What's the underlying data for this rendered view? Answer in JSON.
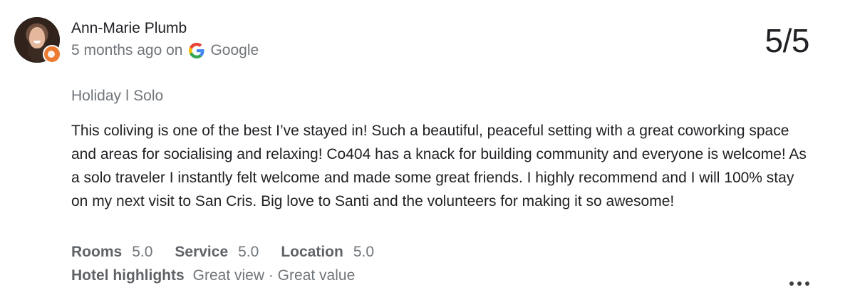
{
  "reviewer": {
    "name": "Ann-Marie Plumb",
    "avatar_icon": "profile-photo",
    "badge_color": "#ec7a2f"
  },
  "meta": {
    "posted": "5 months ago on",
    "source": "Google",
    "source_icon": "google-g-icon"
  },
  "score": "5/5",
  "trip_type": "Holiday ǀ Solo",
  "review_text": "This coliving is one of the best I’ve stayed in! Such a beautiful, peaceful setting with a great coworking space and areas for socialising and relaxing! Co404 has a knack for building community and everyone is welcome! As a solo traveler I instantly felt welcome and made some great friends. I highly recommend and I will 100% stay on my next visit to San Cris. Big love to Santi and the volunteers for making it so awesome!",
  "ratings": [
    {
      "label": "Rooms",
      "value": "5.0"
    },
    {
      "label": "Service",
      "value": "5.0"
    },
    {
      "label": "Location",
      "value": "5.0"
    }
  ],
  "highlights": {
    "label": "Hotel highlights",
    "value": "Great view · Great value"
  },
  "actions": {
    "more_icon": "more-horizontal-icon"
  }
}
